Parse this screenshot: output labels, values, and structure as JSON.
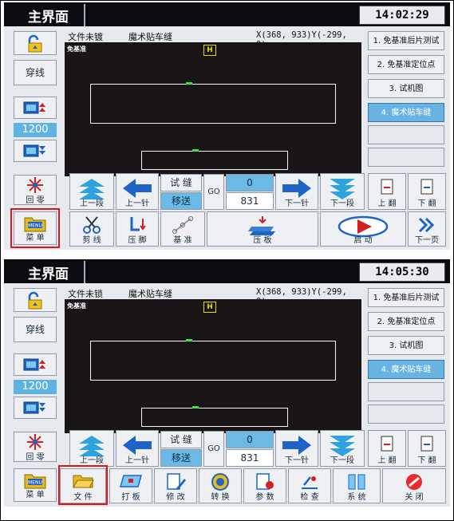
{
  "screens": [
    {
      "title": "主界面",
      "time": "14:02:29",
      "file_status": "文件未镀",
      "pattern_name": "魔术贴车缝",
      "coords": "X(368, 933)Y(-299, 0)",
      "canvas_label": "免基准",
      "right_menu": [
        "1. 免基准后片测试",
        "2. 免基准定位点",
        "3. 试机图",
        "4. 魔术贴车缝"
      ],
      "selected_right_index": 3,
      "left_buttons": {
        "thread": "穿线",
        "speed": "1200",
        "home": "回 零",
        "menu": "菜 单"
      },
      "sew_mode": {
        "top": "试 缝",
        "bottom": "移送"
      },
      "go_label": "GO",
      "counter": {
        "current": "0",
        "total": "831"
      },
      "nav": {
        "prev_segment": "上一段",
        "prev_stitch": "上一针",
        "next_stitch": "下一针",
        "next_segment": "下一段",
        "page_up": "上 翻",
        "page_down": "下 翻"
      },
      "bottom_bar": [
        "剪 线",
        "压 脚",
        "基 准",
        "压 板",
        "启 动",
        "下一页"
      ],
      "highlight": "menu-button"
    },
    {
      "title": "主界面",
      "time": "14:05:30",
      "file_status": "文件未锁",
      "pattern_name": "魔术贴车缝",
      "coords": "X(368, 933)Y(-299, 0)",
      "canvas_label": "免基准",
      "right_menu": [
        "1. 免基准后片测试",
        "2. 免基准定位点",
        "3. 试机图",
        "4. 魔术贴车缝"
      ],
      "selected_right_index": 3,
      "left_buttons": {
        "thread": "穿线",
        "speed": "1200",
        "home": "回 零",
        "menu": "菜 单"
      },
      "sew_mode": {
        "top": "试 缝",
        "bottom": "移送"
      },
      "go_label": "GO",
      "counter": {
        "current": "0",
        "total": "831"
      },
      "nav": {
        "prev_segment": "上一段",
        "prev_stitch": "上一针",
        "next_stitch": "下一针",
        "next_segment": "下一段",
        "page_up": "上 翻",
        "page_down": "下 翻"
      },
      "bottom_bar": [
        "文 件",
        "打 板",
        "修 改",
        "转 换",
        "参 数",
        "检 查",
        "系 统",
        "关 闭"
      ],
      "highlight": "file-button"
    }
  ],
  "colors": {
    "selected": "#68b3e2",
    "highlight": "#e0141b",
    "screen_bg": "#191516",
    "topbar": "#0c0c10",
    "accent_blue": "#1e64c8"
  }
}
